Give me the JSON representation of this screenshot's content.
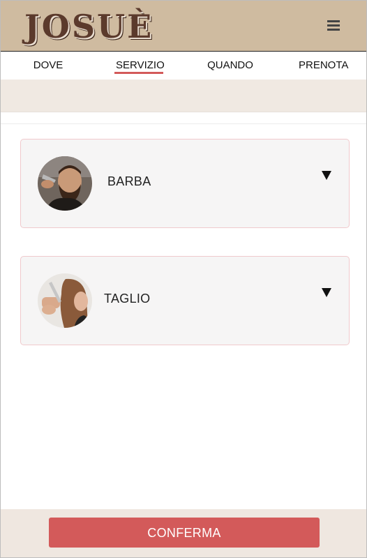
{
  "header": {
    "logo_text": "JOSUÈ",
    "menu_icon": "hamburger-icon"
  },
  "nav": {
    "tabs": [
      {
        "label": "DOVE"
      },
      {
        "label": "SERVIZIO",
        "active": true
      },
      {
        "label": "QUANDO"
      },
      {
        "label": "PRENOTA"
      }
    ]
  },
  "services": [
    {
      "label": "BARBA",
      "icon": "caret-down-icon"
    },
    {
      "label": "TAGLIO",
      "icon": "caret-down-icon"
    }
  ],
  "footer": {
    "confirm_label": "CONFERMA"
  },
  "colors": {
    "header_bg": "#cfbba0",
    "accent": "#d35a5a",
    "subbar_bg": "#f0e9e2",
    "card_border": "#f0c9cc"
  }
}
